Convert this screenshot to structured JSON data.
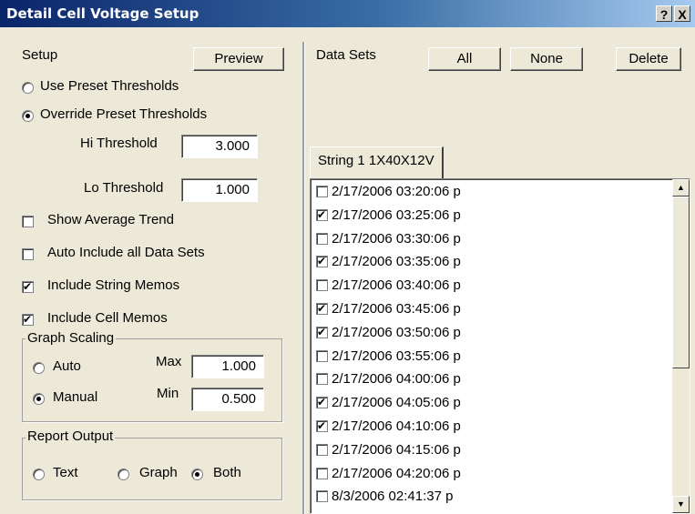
{
  "window": {
    "title": "Detail Cell Voltage Setup",
    "help_glyph": "?",
    "close_glyph": "X"
  },
  "setup": {
    "label": "Setup",
    "preview_label": "Preview",
    "use_preset_label": "Use Preset Thresholds",
    "override_preset_label": "Override Preset Thresholds",
    "threshold_mode": "override",
    "hi_threshold_label": "Hi Threshold",
    "hi_threshold_value": "3.000",
    "lo_threshold_label": "Lo Threshold",
    "lo_threshold_value": "1.000",
    "show_average_trend_label": "Show Average Trend",
    "show_average_trend": false,
    "auto_include_label": "Auto Include all Data Sets",
    "auto_include": false,
    "include_string_memos_label": "Include String Memos",
    "include_string_memos": true,
    "include_cell_memos_label": "Include Cell Memos",
    "include_cell_memos": true
  },
  "graph_scaling": {
    "label": "Graph Scaling",
    "auto_label": "Auto",
    "manual_label": "Manual",
    "selected": "manual",
    "max_label": "Max",
    "max_value": "1.000",
    "min_label": "Min",
    "min_value": "0.500"
  },
  "report_output": {
    "label": "Report Output",
    "text_label": "Text",
    "graph_label": "Graph",
    "both_label": "Both",
    "selected": "both"
  },
  "data_sets": {
    "label": "Data Sets",
    "all_label": "All",
    "none_label": "None",
    "delete_label": "Delete",
    "tab_label": "String 1 1X40X12V",
    "items": [
      {
        "label": "2/17/2006 03:20:06 p",
        "checked": false
      },
      {
        "label": "2/17/2006 03:25:06 p",
        "checked": true
      },
      {
        "label": "2/17/2006 03:30:06 p",
        "checked": false
      },
      {
        "label": "2/17/2006 03:35:06 p",
        "checked": true
      },
      {
        "label": "2/17/2006 03:40:06 p",
        "checked": false
      },
      {
        "label": "2/17/2006 03:45:06 p",
        "checked": true
      },
      {
        "label": "2/17/2006 03:50:06 p",
        "checked": true
      },
      {
        "label": "2/17/2006 03:55:06 p",
        "checked": false
      },
      {
        "label": "2/17/2006 04:00:06 p",
        "checked": false
      },
      {
        "label": "2/17/2006 04:05:06 p",
        "checked": true
      },
      {
        "label": "2/17/2006 04:10:06 p",
        "checked": true
      },
      {
        "label": "2/17/2006 04:15:06 p",
        "checked": false
      },
      {
        "label": "2/17/2006 04:20:06 p",
        "checked": false
      },
      {
        "label": "8/3/2006 02:41:37 p",
        "checked": false
      }
    ]
  },
  "icons": {
    "up": "scroll-up-arrow-icon",
    "down": "scroll-down-arrow-icon"
  }
}
